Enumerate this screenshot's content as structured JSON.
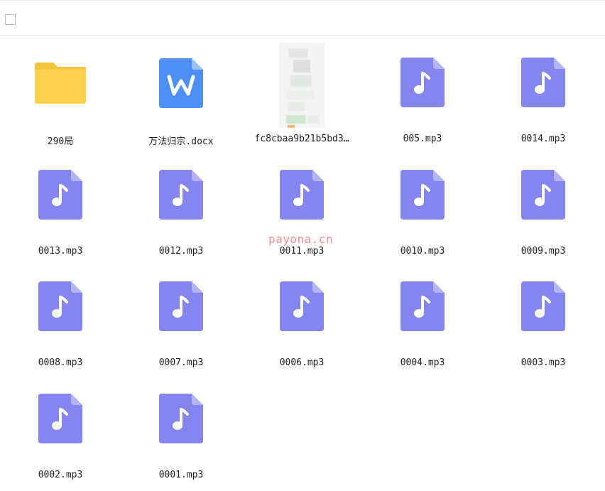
{
  "toolbar": {
    "select_all_checked": false
  },
  "watermark": "payona.cn",
  "colors": {
    "folder": "#FFD24F",
    "folder_tab": "#F5C43A",
    "docx": "#4D8FF5",
    "audio": "#8585F0",
    "audio_fold": "#B3B3F7"
  },
  "files": [
    {
      "name": "290局",
      "type": "folder",
      "icon": "folder-icon"
    },
    {
      "name": "万法归宗.docx",
      "type": "docx",
      "icon": "word-doc-icon"
    },
    {
      "name": "fc8cbaa9b21b5bd3…",
      "type": "image",
      "icon": "image-thumbnail"
    },
    {
      "name": "005.mp3",
      "type": "audio",
      "icon": "music-file-icon"
    },
    {
      "name": "0014.mp3",
      "type": "audio",
      "icon": "music-file-icon"
    },
    {
      "name": "0013.mp3",
      "type": "audio",
      "icon": "music-file-icon"
    },
    {
      "name": "0012.mp3",
      "type": "audio",
      "icon": "music-file-icon"
    },
    {
      "name": "0011.mp3",
      "type": "audio",
      "icon": "music-file-icon"
    },
    {
      "name": "0010.mp3",
      "type": "audio",
      "icon": "music-file-icon"
    },
    {
      "name": "0009.mp3",
      "type": "audio",
      "icon": "music-file-icon"
    },
    {
      "name": "0008.mp3",
      "type": "audio",
      "icon": "music-file-icon"
    },
    {
      "name": "0007.mp3",
      "type": "audio",
      "icon": "music-file-icon"
    },
    {
      "name": "0006.mp3",
      "type": "audio",
      "icon": "music-file-icon"
    },
    {
      "name": "0004.mp3",
      "type": "audio",
      "icon": "music-file-icon"
    },
    {
      "name": "0003.mp3",
      "type": "audio",
      "icon": "music-file-icon"
    },
    {
      "name": "0002.mp3",
      "type": "audio",
      "icon": "music-file-icon"
    },
    {
      "name": "0001.mp3",
      "type": "audio",
      "icon": "music-file-icon"
    }
  ]
}
